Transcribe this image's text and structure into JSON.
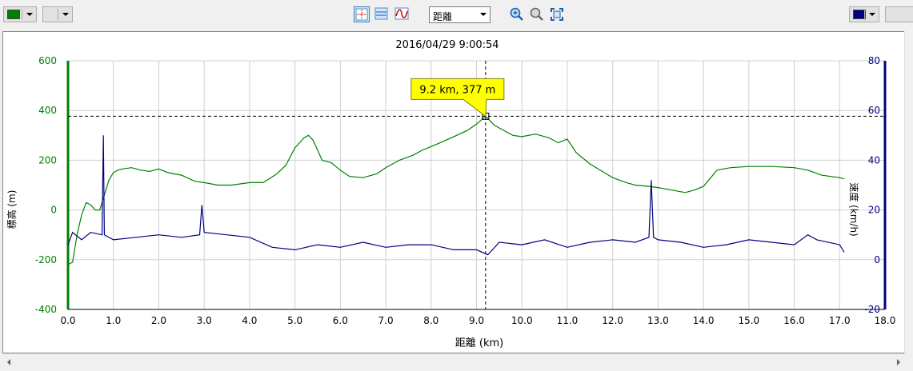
{
  "toolbar": {
    "left_color": "#008000",
    "right_color": "#000080",
    "xaxis_select": "距離",
    "icons": [
      "crosshair-icon",
      "hlines-icon",
      "smooth-curve-icon",
      "zoom-in-icon",
      "zoom-out-icon",
      "fit-icon"
    ]
  },
  "chart_data": {
    "type": "line",
    "title": "2016/04/29 9:00:54",
    "xlabel": "距離 (km)",
    "ylabel_left": "標高 (m)",
    "ylabel_right": "速度 (km/h)",
    "xlim": [
      0,
      18
    ],
    "ylim_left": [
      -400,
      600
    ],
    "ylim_right": [
      -20,
      80
    ],
    "x_ticks": [
      "0.0",
      "1.0",
      "2.0",
      "3.0",
      "4.0",
      "5.0",
      "6.0",
      "7.0",
      "8.0",
      "9.0",
      "10.0",
      "11.0",
      "12.0",
      "13.0",
      "14.0",
      "15.0",
      "16.0",
      "17.0",
      "18.0"
    ],
    "y_ticks_left": [
      "600",
      "400",
      "200",
      "0",
      "-200",
      "-400"
    ],
    "y_ticks_right": [
      "80",
      "60",
      "40",
      "20",
      "0",
      "-20"
    ],
    "grid": true,
    "series": [
      {
        "color": "#008000",
        "axis": "left",
        "x": [
          0.0,
          0.1,
          0.2,
          0.3,
          0.4,
          0.5,
          0.6,
          0.7,
          0.8,
          0.9,
          1.0,
          1.1,
          1.2,
          1.4,
          1.6,
          1.8,
          2.0,
          2.2,
          2.5,
          2.8,
          3.0,
          3.3,
          3.6,
          4.0,
          4.3,
          4.6,
          4.8,
          5.0,
          5.1,
          5.2,
          5.3,
          5.4,
          5.6,
          5.8,
          6.0,
          6.2,
          6.5,
          6.8,
          7.0,
          7.3,
          7.6,
          7.8,
          8.0,
          8.2,
          8.5,
          8.8,
          9.0,
          9.2,
          9.4,
          9.6,
          9.8,
          10.0,
          10.3,
          10.6,
          10.8,
          11.0,
          11.2,
          11.5,
          12.0,
          12.3,
          12.5,
          12.8,
          13.0,
          13.3,
          13.6,
          13.8,
          14.0,
          14.3,
          14.6,
          15.0,
          15.5,
          16.0,
          16.3,
          16.6,
          17.0,
          17.1
        ],
        "y": [
          -220,
          -210,
          -100,
          -20,
          30,
          20,
          0,
          0,
          60,
          120,
          150,
          160,
          165,
          170,
          160,
          155,
          165,
          150,
          140,
          115,
          110,
          100,
          100,
          110,
          110,
          145,
          180,
          250,
          270,
          290,
          300,
          280,
          200,
          190,
          160,
          135,
          130,
          145,
          170,
          200,
          220,
          240,
          255,
          270,
          295,
          320,
          345,
          377,
          340,
          320,
          300,
          295,
          305,
          290,
          270,
          285,
          230,
          185,
          130,
          110,
          100,
          95,
          90,
          80,
          70,
          80,
          95,
          160,
          170,
          175,
          175,
          170,
          160,
          140,
          130,
          125
        ]
      },
      {
        "color": "#000080",
        "axis": "right",
        "x": [
          0.0,
          0.1,
          0.3,
          0.5,
          0.75,
          0.78,
          0.8,
          1.0,
          1.5,
          2.0,
          2.5,
          2.9,
          2.95,
          3.0,
          3.5,
          4.0,
          4.5,
          5.0,
          5.5,
          6.0,
          6.5,
          7.0,
          7.5,
          8.0,
          8.5,
          9.0,
          9.25,
          9.5,
          10.0,
          10.5,
          11.0,
          11.5,
          12.0,
          12.5,
          12.8,
          12.85,
          12.9,
          13.0,
          13.5,
          14.0,
          14.5,
          15.0,
          15.5,
          16.0,
          16.3,
          16.5,
          17.0,
          17.1
        ],
        "y": [
          6,
          11,
          8,
          11,
          10,
          50,
          10,
          8,
          9,
          10,
          9,
          10,
          22,
          11,
          10,
          9,
          5,
          4,
          6,
          5,
          7,
          5,
          6,
          6,
          4,
          4,
          2,
          7,
          6,
          8,
          5,
          7,
          8,
          7,
          9,
          32,
          9,
          8,
          7,
          5,
          6,
          8,
          7,
          6,
          10,
          8,
          6,
          3
        ]
      }
    ],
    "cursor": {
      "x": 9.2,
      "y": 377,
      "label": "9.2 km, 377 m"
    }
  }
}
